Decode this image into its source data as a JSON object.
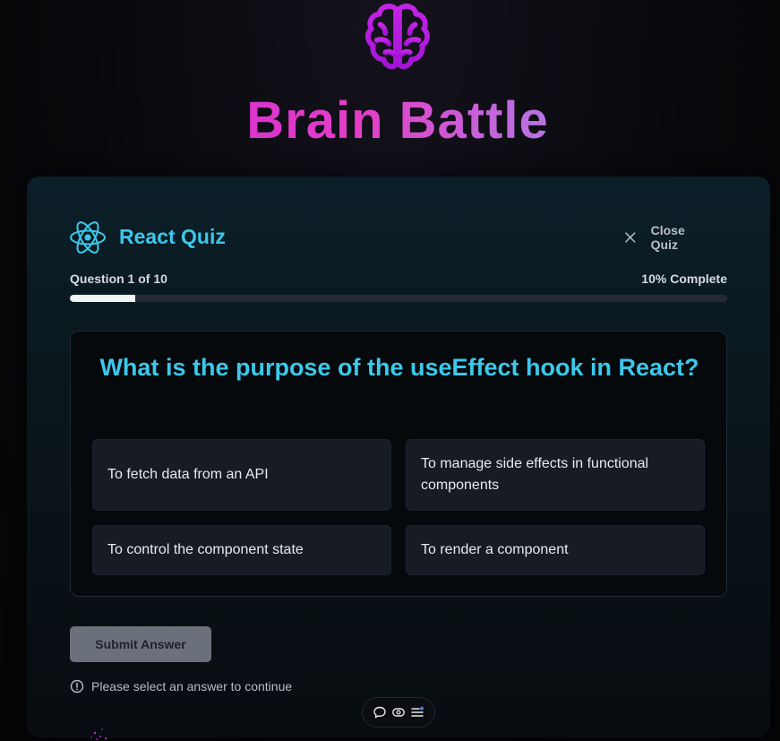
{
  "app": {
    "title": "Brain Battle",
    "brand_gradient": [
      "#c21fd6",
      "#e43ec8",
      "#b07be6",
      "#8fa6f2"
    ],
    "icon": "brain-icon"
  },
  "quiz": {
    "title": "React Quiz",
    "icon": "react-icon",
    "close_label": "Close Quiz",
    "progress_label": "Question 1 of 10",
    "progress_percent_label": "10% Complete",
    "progress_value": 0.1,
    "accent": "#3cc8ea"
  },
  "question": {
    "text": "What is the purpose of the useEffect hook in React?",
    "options": [
      "To fetch data from an API",
      "To manage side effects in functional components",
      "To control the component state",
      "To render a component"
    ]
  },
  "footer": {
    "submit_label": "Submit Answer",
    "hint": "Please select an answer to continue"
  },
  "toolbar": {
    "icons": [
      "chat-icon",
      "eye-icon",
      "menu-icon"
    ]
  }
}
